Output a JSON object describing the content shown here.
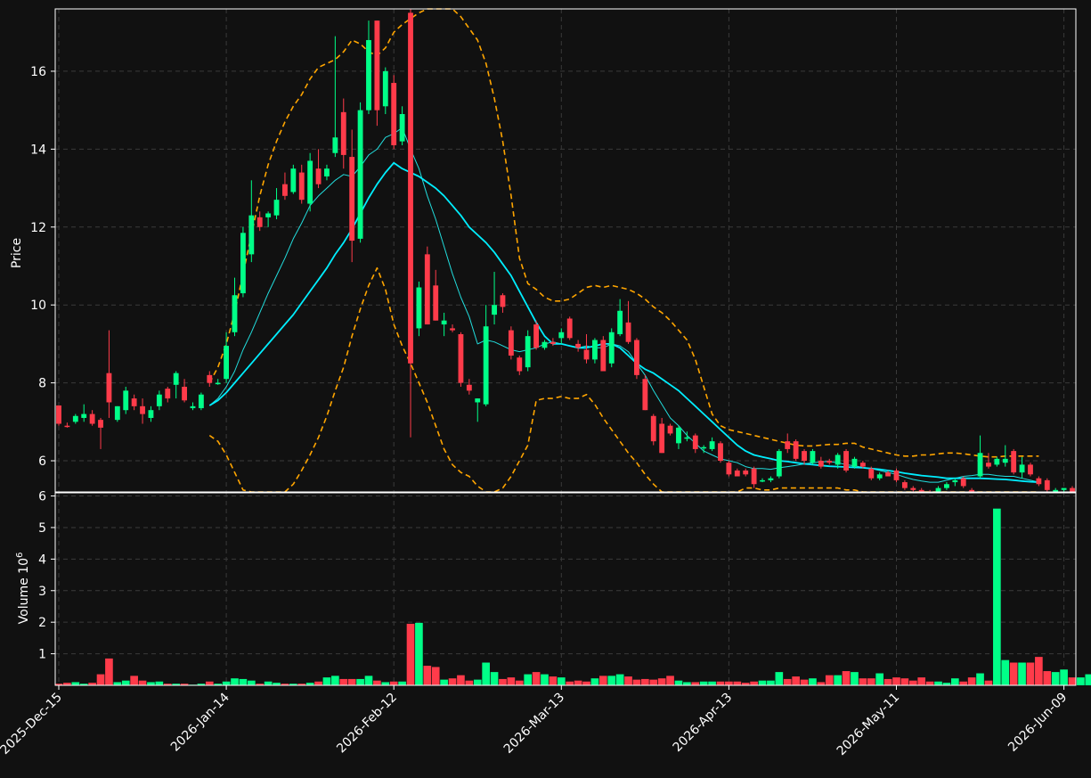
{
  "chart_data": [
    {
      "type": "candlestick",
      "ylabel": "Price",
      "ylim": [
        5.2,
        17.6
      ],
      "yticks": [
        6,
        8,
        10,
        12,
        14,
        16
      ],
      "grid": true,
      "start_date": "2025-12-15",
      "colors": {
        "up": "#00ff88",
        "down": "#ff3b4a",
        "ma_short": "#22dddd",
        "ma_long": "#00eeff",
        "bands": "#ffa500",
        "grid": "#3a3a3a",
        "background": "#111111"
      },
      "ohlc": [
        [
          7.42,
          7.42,
          6.9,
          6.95
        ],
        [
          6.9,
          6.98,
          6.85,
          6.88
        ],
        [
          7.0,
          7.2,
          6.95,
          7.15
        ],
        [
          7.1,
          7.45,
          7.0,
          7.2
        ],
        [
          7.2,
          7.3,
          6.9,
          6.95
        ],
        [
          7.05,
          7.1,
          6.3,
          6.85
        ],
        [
          8.25,
          9.35,
          7.1,
          7.5
        ],
        [
          7.05,
          7.4,
          7.0,
          7.4
        ],
        [
          7.3,
          7.9,
          7.2,
          7.8
        ],
        [
          7.6,
          7.7,
          7.3,
          7.4
        ],
        [
          7.4,
          7.6,
          6.95,
          7.2
        ],
        [
          7.1,
          7.4,
          7.0,
          7.3
        ],
        [
          7.4,
          7.8,
          7.3,
          7.7
        ],
        [
          7.85,
          7.9,
          7.5,
          7.6
        ],
        [
          7.95,
          8.3,
          7.6,
          8.25
        ],
        [
          7.9,
          8.1,
          7.5,
          7.55
        ],
        [
          7.35,
          7.5,
          7.3,
          7.4
        ],
        [
          7.35,
          7.75,
          7.3,
          7.7
        ],
        [
          8.2,
          8.3,
          7.9,
          8.0
        ],
        [
          8.0,
          8.1,
          7.95,
          8.0
        ],
        [
          8.1,
          9.3,
          8.0,
          8.95
        ],
        [
          9.3,
          10.7,
          9.2,
          10.25
        ],
        [
          10.3,
          12.0,
          10.2,
          11.85
        ],
        [
          11.3,
          13.2,
          11.1,
          12.3
        ],
        [
          12.25,
          12.4,
          11.9,
          12.0
        ],
        [
          12.25,
          12.4,
          12.0,
          12.35
        ],
        [
          12.3,
          13.0,
          12.2,
          12.7
        ],
        [
          13.1,
          13.4,
          12.7,
          12.8
        ],
        [
          12.9,
          13.6,
          12.85,
          13.5
        ],
        [
          13.4,
          13.6,
          12.6,
          12.7
        ],
        [
          12.6,
          13.9,
          12.4,
          13.7
        ],
        [
          13.5,
          14.0,
          13.0,
          13.1
        ],
        [
          13.3,
          13.6,
          13.2,
          13.5
        ],
        [
          13.9,
          16.9,
          13.8,
          14.3
        ],
        [
          14.95,
          15.3,
          13.5,
          13.85
        ],
        [
          13.8,
          14.5,
          11.1,
          11.65
        ],
        [
          11.7,
          15.2,
          11.6,
          15.0
        ],
        [
          15.0,
          17.3,
          14.9,
          16.8
        ],
        [
          17.3,
          17.3,
          14.6,
          15.0
        ],
        [
          15.1,
          16.1,
          14.9,
          16.0
        ],
        [
          15.7,
          15.9,
          14.0,
          14.1
        ],
        [
          14.2,
          15.1,
          14.1,
          14.9
        ],
        [
          17.5,
          17.6,
          6.6,
          8.5
        ],
        [
          9.4,
          10.6,
          9.2,
          10.45
        ],
        [
          11.3,
          11.5,
          9.5,
          9.5
        ],
        [
          10.5,
          10.9,
          9.6,
          9.6
        ],
        [
          9.5,
          9.8,
          9.2,
          9.6
        ],
        [
          9.4,
          9.5,
          9.3,
          9.35
        ],
        [
          9.25,
          9.3,
          7.9,
          8.0
        ],
        [
          7.95,
          8.1,
          7.7,
          7.8
        ],
        [
          7.5,
          7.6,
          7.0,
          7.6
        ],
        [
          7.45,
          10.0,
          7.4,
          9.45
        ],
        [
          9.75,
          10.85,
          9.5,
          10.0
        ],
        [
          10.25,
          10.3,
          9.8,
          9.95
        ],
        [
          9.35,
          9.45,
          8.6,
          8.7
        ],
        [
          8.65,
          8.7,
          8.2,
          8.3
        ],
        [
          8.4,
          9.35,
          8.3,
          9.2
        ],
        [
          9.5,
          9.6,
          8.85,
          8.9
        ],
        [
          8.9,
          9.1,
          8.85,
          9.05
        ],
        [
          9.05,
          9.15,
          8.95,
          9.0
        ],
        [
          9.15,
          9.4,
          9.0,
          9.3
        ],
        [
          9.65,
          9.7,
          9.1,
          9.15
        ],
        [
          9.0,
          9.1,
          8.8,
          8.9
        ],
        [
          8.85,
          9.25,
          8.5,
          8.6
        ],
        [
          8.6,
          9.15,
          8.5,
          9.1
        ],
        [
          9.1,
          9.2,
          8.3,
          8.3
        ],
        [
          8.5,
          9.4,
          8.4,
          9.3
        ],
        [
          9.25,
          10.15,
          9.2,
          9.85
        ],
        [
          9.55,
          10.1,
          9.0,
          9.05
        ],
        [
          9.1,
          9.15,
          8.1,
          8.2
        ],
        [
          8.1,
          8.2,
          7.3,
          7.3
        ],
        [
          7.15,
          7.2,
          6.4,
          6.5
        ],
        [
          6.95,
          7.1,
          6.2,
          6.2
        ],
        [
          6.9,
          6.95,
          6.65,
          6.7
        ],
        [
          6.45,
          6.9,
          6.3,
          6.85
        ],
        [
          6.6,
          6.75,
          6.5,
          6.6
        ],
        [
          6.65,
          6.7,
          6.2,
          6.3
        ],
        [
          6.35,
          6.4,
          6.2,
          6.35
        ],
        [
          6.3,
          6.6,
          6.25,
          6.5
        ],
        [
          6.45,
          6.5,
          5.95,
          6.0
        ],
        [
          5.95,
          6.0,
          5.6,
          5.65
        ],
        [
          5.75,
          5.8,
          5.6,
          5.6
        ],
        [
          5.75,
          5.8,
          5.6,
          5.65
        ],
        [
          5.8,
          5.85,
          5.3,
          5.4
        ],
        [
          5.5,
          5.55,
          5.45,
          5.5
        ],
        [
          5.5,
          5.6,
          5.45,
          5.55
        ],
        [
          5.6,
          6.3,
          5.55,
          6.25
        ],
        [
          6.5,
          6.7,
          6.2,
          6.3
        ],
        [
          6.5,
          6.55,
          6.0,
          6.05
        ],
        [
          6.25,
          6.3,
          5.9,
          6.0
        ],
        [
          5.95,
          6.3,
          5.9,
          6.25
        ],
        [
          6.0,
          6.1,
          5.8,
          5.85
        ],
        [
          6.0,
          6.05,
          5.9,
          5.95
        ],
        [
          5.9,
          6.2,
          5.8,
          6.15
        ],
        [
          6.25,
          6.3,
          5.7,
          5.75
        ],
        [
          5.85,
          6.1,
          5.8,
          6.05
        ],
        [
          5.95,
          6.0,
          5.8,
          5.85
        ],
        [
          5.8,
          5.85,
          5.5,
          5.55
        ],
        [
          5.55,
          5.7,
          5.5,
          5.65
        ],
        [
          5.7,
          5.75,
          5.6,
          5.6
        ],
        [
          5.75,
          5.8,
          5.45,
          5.5
        ],
        [
          5.45,
          5.5,
          5.25,
          5.3
        ],
        [
          5.3,
          5.35,
          5.2,
          5.25
        ],
        [
          5.25,
          5.3,
          5.1,
          5.15
        ],
        [
          5.2,
          5.25,
          5.1,
          5.15
        ],
        [
          5.1,
          5.35,
          5.05,
          5.3
        ],
        [
          5.3,
          5.45,
          5.25,
          5.4
        ],
        [
          5.45,
          5.55,
          5.35,
          5.5
        ],
        [
          5.55,
          5.6,
          5.3,
          5.35
        ],
        [
          5.25,
          5.3,
          5.1,
          5.15
        ],
        [
          5.6,
          6.65,
          5.55,
          6.2
        ],
        [
          5.95,
          6.2,
          5.8,
          5.85
        ],
        [
          5.9,
          6.1,
          5.85,
          6.05
        ],
        [
          5.95,
          6.4,
          5.85,
          6.05
        ],
        [
          6.25,
          6.3,
          5.65,
          5.7
        ],
        [
          5.7,
          6.1,
          5.55,
          5.9
        ],
        [
          5.9,
          5.95,
          5.6,
          5.65
        ],
        [
          5.55,
          5.6,
          5.35,
          5.4
        ],
        [
          5.5,
          5.55,
          5.2,
          5.25
        ],
        [
          5.2,
          5.3,
          5.15,
          5.25
        ],
        [
          5.25,
          5.3,
          5.2,
          5.3
        ],
        [
          5.3,
          5.35,
          5.0,
          5.1
        ]
      ],
      "ma_short": {
        "start_index": 18,
        "values": [
          7.42,
          7.6,
          7.9,
          8.3,
          8.85,
          9.3,
          9.8,
          10.3,
          10.75,
          11.2,
          11.7,
          12.1,
          12.55,
          12.8,
          13.0,
          13.2,
          13.35,
          13.3,
          13.55,
          13.85,
          14.0,
          14.3,
          14.4,
          14.55,
          14.0,
          13.5,
          12.8,
          12.2,
          11.5,
          10.8,
          10.2,
          9.7,
          9.0,
          9.1,
          9.05,
          8.95,
          8.85,
          8.8,
          8.85,
          8.9,
          9.0,
          9.05,
          9.0,
          8.95,
          8.9,
          8.95,
          8.9,
          8.9,
          9.0,
          8.95,
          8.8,
          8.5,
          8.2,
          7.8,
          7.45,
          7.1,
          6.9,
          6.65,
          6.45,
          6.25,
          6.15,
          6.05,
          6.0,
          5.95,
          5.85,
          5.8,
          5.8,
          5.78,
          5.82,
          5.85,
          5.88,
          5.92,
          5.95,
          5.97,
          5.98,
          5.95,
          5.9,
          5.87,
          5.83,
          5.8,
          5.75,
          5.7,
          5.65,
          5.58,
          5.52,
          5.48,
          5.45,
          5.45,
          5.5,
          5.55,
          5.6,
          5.62,
          5.65,
          5.65,
          5.62,
          5.6,
          5.6,
          5.55,
          5.5,
          5.45
        ]
      },
      "ma_long": {
        "start_index": 18,
        "values": [
          7.42,
          7.55,
          7.75,
          8.0,
          8.25,
          8.5,
          8.75,
          9.0,
          9.25,
          9.5,
          9.75,
          10.05,
          10.35,
          10.65,
          10.95,
          11.3,
          11.6,
          11.95,
          12.35,
          12.75,
          13.1,
          13.4,
          13.65,
          13.5,
          13.4,
          13.3,
          13.15,
          13.0,
          12.8,
          12.55,
          12.3,
          12.0,
          11.8,
          11.6,
          11.35,
          11.05,
          10.75,
          10.35,
          9.95,
          9.55,
          9.2,
          9.0,
          9.0,
          8.95,
          8.9,
          8.9,
          8.95,
          9.0,
          9.0,
          8.9,
          8.7,
          8.5,
          8.35,
          8.25,
          8.1,
          7.95,
          7.8,
          7.6,
          7.4,
          7.2,
          7.0,
          6.8,
          6.6,
          6.4,
          6.25,
          6.15,
          6.1,
          6.05,
          6.0,
          5.98,
          5.95,
          5.92,
          5.9,
          5.88,
          5.86,
          5.85,
          5.84,
          5.83,
          5.82,
          5.8,
          5.78,
          5.75,
          5.72,
          5.68,
          5.65,
          5.62,
          5.6,
          5.58,
          5.55,
          5.55,
          5.55,
          5.55,
          5.55,
          5.54,
          5.53,
          5.52,
          5.5,
          5.48,
          5.46,
          5.45
        ]
      },
      "upper_band": {
        "start_index": 18,
        "values": [
          8.0,
          8.4,
          9.0,
          9.8,
          10.8,
          11.8,
          12.8,
          13.6,
          14.2,
          14.7,
          15.1,
          15.4,
          15.8,
          16.1,
          16.2,
          16.3,
          16.5,
          16.8,
          16.7,
          16.5,
          16.4,
          16.6,
          17.0,
          17.2,
          17.35,
          17.5,
          17.6,
          17.7,
          17.7,
          17.65,
          17.4,
          17.1,
          16.8,
          16.2,
          15.3,
          14.2,
          12.8,
          11.2,
          10.55,
          10.4,
          10.2,
          10.1,
          10.1,
          10.15,
          10.3,
          10.45,
          10.5,
          10.45,
          10.5,
          10.45,
          10.4,
          10.3,
          10.15,
          9.95,
          9.8,
          9.6,
          9.35,
          9.1,
          8.6,
          7.9,
          7.2,
          6.9,
          6.8,
          6.75,
          6.7,
          6.65,
          6.6,
          6.55,
          6.5,
          6.45,
          6.4,
          6.38,
          6.38,
          6.4,
          6.42,
          6.42,
          6.45,
          6.45,
          6.35,
          6.3,
          6.25,
          6.2,
          6.15,
          6.12,
          6.12,
          6.15,
          6.15,
          6.18,
          6.2,
          6.2,
          6.18,
          6.15,
          6.12,
          6.1,
          6.1,
          6.12,
          6.12,
          6.12,
          6.12,
          6.12
        ]
      },
      "lower_band": {
        "start_index": 18,
        "values": [
          6.65,
          6.5,
          6.15,
          5.7,
          5.25,
          5.1,
          4.95,
          4.85,
          4.9,
          5.1,
          5.4,
          5.75,
          6.15,
          6.6,
          7.15,
          7.8,
          8.4,
          9.2,
          9.9,
          10.5,
          10.95,
          10.4,
          9.5,
          8.95,
          8.5,
          8.0,
          7.5,
          6.9,
          6.3,
          5.9,
          5.7,
          5.6,
          5.35,
          5.1,
          5.05,
          5.3,
          5.6,
          6.0,
          6.4,
          7.55,
          7.6,
          7.6,
          7.65,
          7.6,
          7.6,
          7.7,
          7.45,
          7.1,
          6.8,
          6.5,
          6.2,
          5.95,
          5.65,
          5.4,
          5.2,
          4.95,
          4.7,
          4.45,
          4.2,
          4.05,
          4.0,
          4.3,
          4.6,
          5.0,
          5.3,
          5.3,
          5.25,
          5.25,
          5.3,
          5.3,
          5.3,
          5.3,
          5.3,
          5.3,
          5.3,
          5.3,
          5.25,
          5.25,
          5.2,
          5.15,
          5.1,
          5.05,
          5.05,
          5.0,
          5.0,
          4.95,
          4.95,
          4.9,
          4.9,
          4.9,
          4.88,
          4.88,
          4.86,
          4.86,
          4.85,
          4.82,
          4.8,
          4.75,
          4.7,
          4.68
        ]
      }
    },
    {
      "type": "bar",
      "ylabel": "Volume  10",
      "ylabel_exponent": "6",
      "ylim": [
        0,
        6.1
      ],
      "yticks": [
        1,
        2,
        3,
        4,
        5,
        6
      ],
      "grid": true,
      "volume": [
        0.05,
        0.08,
        0.1,
        0.05,
        0.08,
        0.35,
        0.85,
        0.1,
        0.15,
        0.3,
        0.15,
        0.1,
        0.12,
        0.05,
        0.05,
        0.05,
        0.02,
        0.05,
        0.12,
        0.05,
        0.12,
        0.22,
        0.2,
        0.15,
        0.05,
        0.12,
        0.08,
        0.05,
        0.05,
        0.05,
        0.08,
        0.12,
        0.25,
        0.3,
        0.2,
        0.2,
        0.2,
        0.3,
        0.15,
        0.1,
        0.12,
        0.12,
        1.95,
        1.98,
        0.62,
        0.58,
        0.18,
        0.22,
        0.32,
        0.15,
        0.18,
        0.72,
        0.42,
        0.2,
        0.25,
        0.15,
        0.35,
        0.42,
        0.35,
        0.28,
        0.25,
        0.12,
        0.15,
        0.12,
        0.22,
        0.3,
        0.3,
        0.35,
        0.28,
        0.18,
        0.2,
        0.18,
        0.22,
        0.3,
        0.15,
        0.1,
        0.1,
        0.12,
        0.12,
        0.12,
        0.12,
        0.12,
        0.08,
        0.12,
        0.15,
        0.15,
        0.42,
        0.2,
        0.28,
        0.18,
        0.22,
        0.1,
        0.32,
        0.32,
        0.45,
        0.42,
        0.22,
        0.22,
        0.38,
        0.2,
        0.25,
        0.22,
        0.15,
        0.25,
        0.12,
        0.12,
        0.08,
        0.22,
        0.12,
        0.25,
        0.38,
        0.15,
        5.6,
        0.8,
        0.72,
        0.72,
        0.72,
        0.9,
        0.45,
        0.42,
        0.5,
        0.25,
        0.25,
        0.35
      ]
    }
  ],
  "x_axis": {
    "tick_labels": [
      {
        "label": "2025-Dec-15",
        "index": 0
      },
      {
        "label": "2026-Jan-14",
        "index": 20
      },
      {
        "label": "2026-Feb-12",
        "index": 40
      },
      {
        "label": "2026-Mar-13",
        "index": 60
      },
      {
        "label": "2026-Apr-13",
        "index": 80
      },
      {
        "label": "2026-May-11",
        "index": 100
      },
      {
        "label": "2026-Jun-09",
        "index": 120
      }
    ]
  }
}
